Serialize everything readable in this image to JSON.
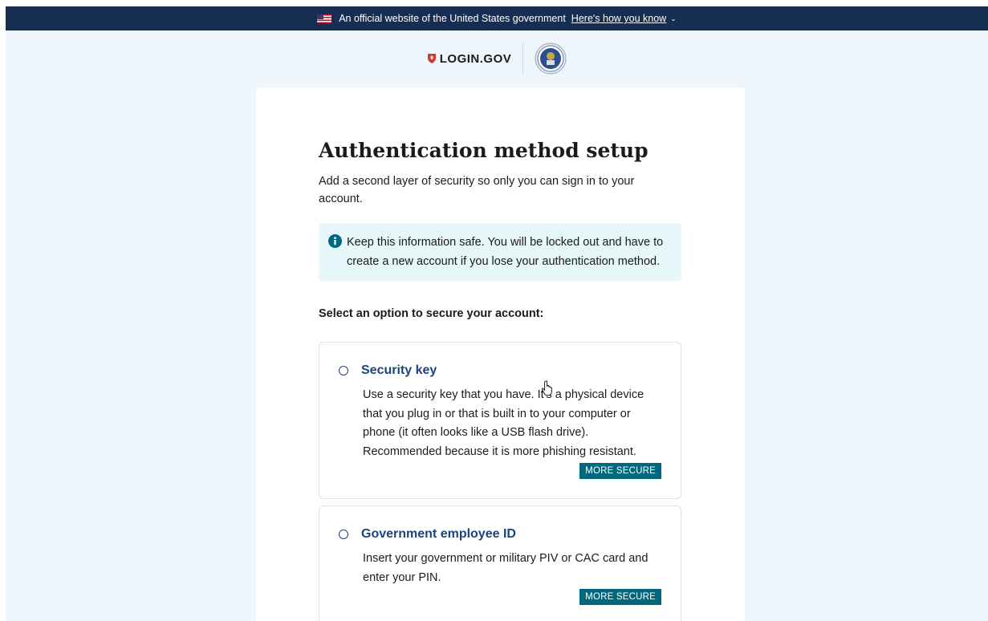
{
  "banner": {
    "text": "An official website of the United States government",
    "link": "Here's how you know",
    "chevron": "⌄"
  },
  "header": {
    "logo_text": "LOGIN.GOV",
    "brand_color": "#d83933",
    "seal_icon": "agency-seal-icon"
  },
  "main": {
    "title": "Authentication method setup",
    "intro": "Add a second layer of security so only you can sign in to your account.",
    "alert": "Keep this information safe. You will be locked out and have to create a new account if you lose your authentication method.",
    "select_label": "Select an option to secure your account:",
    "options": [
      {
        "title": "Security key",
        "description": "Use a security key that you have. It's a physical device that you plug in or that is built in to your computer or phone (it often looks like a USB flash drive). Recommended because it is more phishing resistant.",
        "badge": "MORE SECURE"
      },
      {
        "title": "Government employee ID",
        "description": "Insert your government or military PIV or CAC card and enter your PIN.",
        "badge": "MORE SECURE"
      }
    ]
  },
  "colors": {
    "banner_bg": "#162e51",
    "page_bg": "#eff6fb",
    "link_blue": "#1a4480",
    "badge_teal": "#00687d",
    "alert_bg": "#e7f6f8"
  }
}
